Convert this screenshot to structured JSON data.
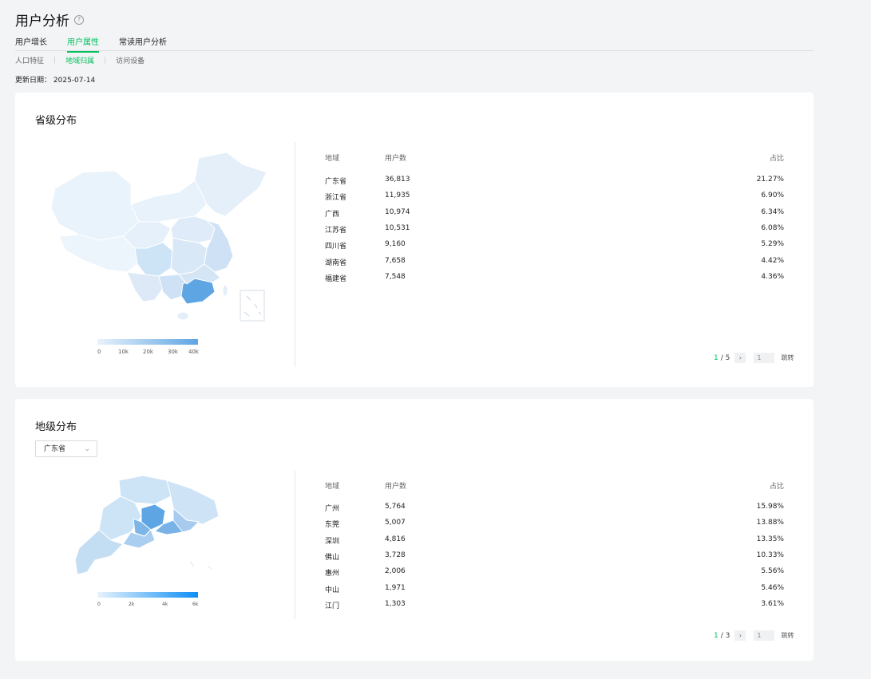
{
  "page": {
    "title": "用户分析",
    "help_icon": "question-circle-icon",
    "tabs": [
      "用户增长",
      "用户属性",
      "常读用户分析"
    ],
    "active_tab": "用户属性",
    "subtabs": [
      "人口特征",
      "地域归属",
      "访问设备"
    ],
    "active_subtab": "地域归属",
    "update_label": "更新日期：",
    "update_date": "2025-07-14",
    "accent_color": "#07c160"
  },
  "province": {
    "title": "省级分布",
    "headers": {
      "region": "地域",
      "users": "用户数",
      "ratio": "占比"
    },
    "rows": [
      {
        "region": "广东省",
        "users": "36,813",
        "ratio": "21.27%"
      },
      {
        "region": "浙江省",
        "users": "11,935",
        "ratio": "6.90%"
      },
      {
        "region": "广西",
        "users": "10,974",
        "ratio": "6.34%"
      },
      {
        "region": "江苏省",
        "users": "10,531",
        "ratio": "6.08%"
      },
      {
        "region": "四川省",
        "users": "9,160",
        "ratio": "5.29%"
      },
      {
        "region": "湖南省",
        "users": "7,658",
        "ratio": "4.42%"
      },
      {
        "region": "福建省",
        "users": "7,548",
        "ratio": "4.36%"
      }
    ],
    "legend": [
      "0",
      "10k",
      "20k",
      "30k",
      "40k"
    ],
    "pager": {
      "current": "1",
      "total": "/ 5",
      "next_icon": "chevron-right-icon",
      "input": "1",
      "jump": "跳转"
    }
  },
  "city": {
    "title": "地级分布",
    "select_value": "广东省",
    "select_icon": "chevron-down-icon",
    "headers": {
      "region": "地域",
      "users": "用户数",
      "ratio": "占比"
    },
    "rows": [
      {
        "region": "广州",
        "users": "5,764",
        "ratio": "15.98%"
      },
      {
        "region": "东莞",
        "users": "5,007",
        "ratio": "13.88%"
      },
      {
        "region": "深圳",
        "users": "4,816",
        "ratio": "13.35%"
      },
      {
        "region": "佛山",
        "users": "3,728",
        "ratio": "10.33%"
      },
      {
        "region": "惠州",
        "users": "2,006",
        "ratio": "5.56%"
      },
      {
        "region": "中山",
        "users": "1,971",
        "ratio": "5.46%"
      },
      {
        "region": "江门",
        "users": "1,303",
        "ratio": "3.61%"
      }
    ],
    "legend": [
      "0",
      "2k",
      "4k",
      "6k"
    ],
    "pager": {
      "current": "1",
      "total": "/ 3",
      "next_icon": "chevron-right-icon",
      "input": "1",
      "jump": "跳转"
    }
  }
}
